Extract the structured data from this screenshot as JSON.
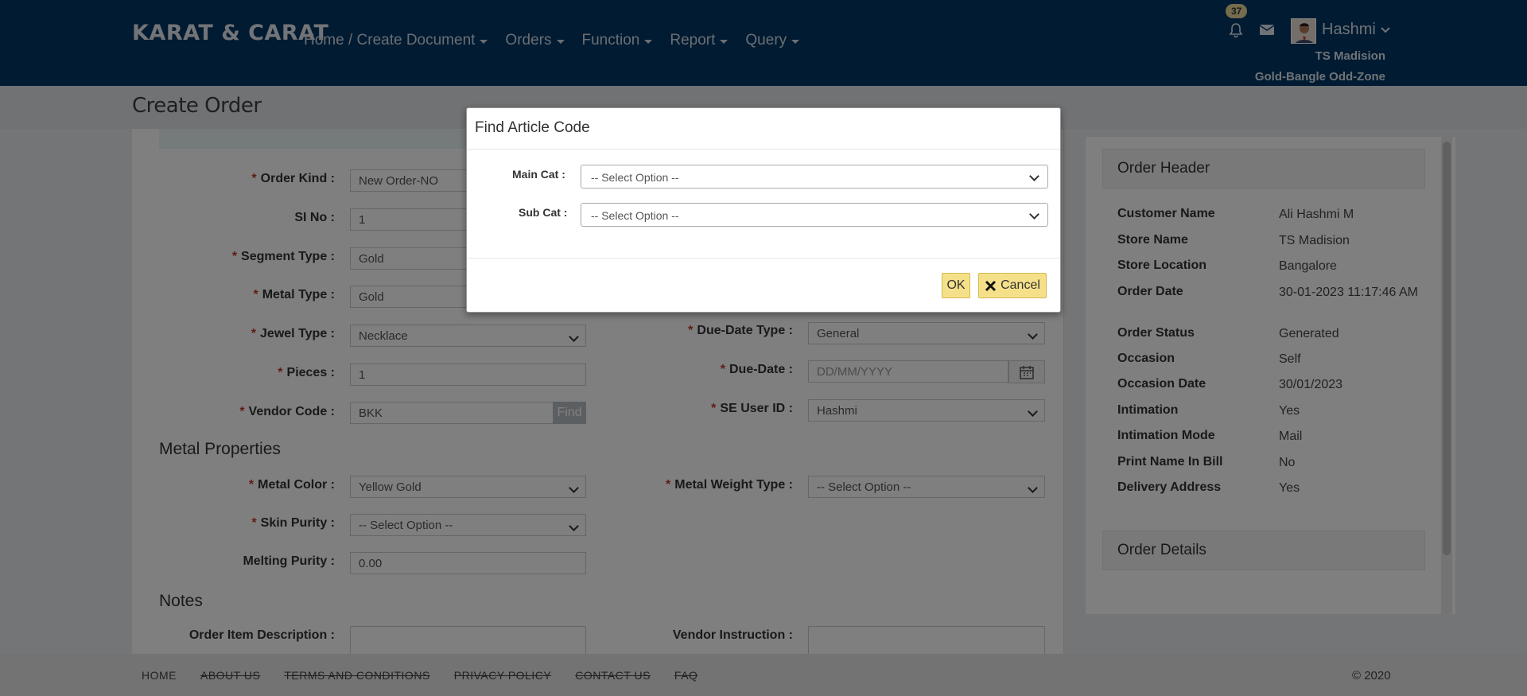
{
  "header": {
    "brand": "KARAT & CARAT",
    "nav": [
      "Home / Create Document",
      "Orders",
      "Function",
      "Report",
      "Query"
    ],
    "notification_count": "37",
    "user_name": "Hashmi",
    "store_name": "TS Madision",
    "store_zone": "Gold-Bangle Odd-Zone"
  },
  "page": {
    "title": "Create Order"
  },
  "form": {
    "order_kind": {
      "label": "Order Kind :",
      "value": "New Order-NO"
    },
    "si_no": {
      "label": "SI No :",
      "value": "1"
    },
    "segment_type": {
      "label": "Segment Type :",
      "value": "Gold"
    },
    "metal_type": {
      "label": "Metal Type :",
      "value": "Gold"
    },
    "jewel_type": {
      "label": "Jewel Type :",
      "value": "Necklace"
    },
    "pieces": {
      "label": "Pieces :",
      "value": "1"
    },
    "vendor_code": {
      "label": "Vendor Code :",
      "value": "BKK",
      "find_label": "Find"
    },
    "due_date_type": {
      "label": "Due-Date Type :",
      "value": "General"
    },
    "due_date": {
      "label": "Due-Date :",
      "placeholder": "DD/MM/YYYY"
    },
    "se_user_id": {
      "label": "SE User ID :",
      "value": "Hashmi"
    },
    "metal_properties_heading": "Metal Properties",
    "metal_color": {
      "label": "Metal Color :",
      "value": "Yellow Gold"
    },
    "metal_weight_type": {
      "label": "Metal Weight Type :",
      "value": "-- Select Option --"
    },
    "skin_purity": {
      "label": "Skin Purity :",
      "value": "-- Select Option --"
    },
    "melting_purity": {
      "label": "Melting Purity :",
      "value": "0.00"
    },
    "notes_heading": "Notes",
    "order_item_description": {
      "label": "Order Item Description :"
    },
    "vendor_instruction": {
      "label": "Vendor Instruction :"
    }
  },
  "order_header": {
    "title": "Order Header",
    "rows": [
      {
        "label": "Customer Name",
        "value": "Ali Hashmi M"
      },
      {
        "label": "Store Name",
        "value": "TS Madision"
      },
      {
        "label": "Store Location",
        "value": "Bangalore"
      },
      {
        "label": "Order Date",
        "value": "30-01-2023 11:17:46 AM"
      },
      {
        "label": "Order Status",
        "value": "Generated"
      },
      {
        "label": "Occasion",
        "value": "Self"
      },
      {
        "label": "Occasion Date",
        "value": "30/01/2023"
      },
      {
        "label": "Intimation",
        "value": "Yes"
      },
      {
        "label": "Intimation Mode",
        "value": "Mail"
      },
      {
        "label": "Print Name In Bill",
        "value": "No"
      },
      {
        "label": "Delivery Address",
        "value": "Yes"
      }
    ]
  },
  "order_details": {
    "title": "Order Details"
  },
  "modal": {
    "title": "Find Article Code",
    "main_cat_label": "Main Cat :",
    "main_cat_value": "-- Select Option --",
    "sub_cat_label": "Sub Cat :",
    "sub_cat_value": "-- Select Option --",
    "ok_label": "OK",
    "cancel_label": "Cancel"
  },
  "footer": {
    "links": [
      "HOME",
      "ABOUT US",
      "TERMS AND CONDITIONS",
      "PRIVACY POLICY",
      "CONTACT US",
      "FAQ"
    ],
    "copyright": "© 2020"
  },
  "colors": {
    "header_bg": "#003764",
    "required": "#c0392b",
    "modal_button": "#f5e08a"
  }
}
